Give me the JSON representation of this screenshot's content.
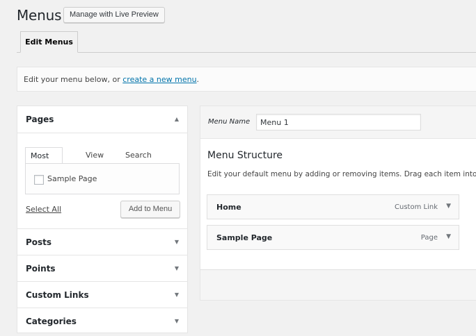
{
  "header": {
    "title": "Menus",
    "live_preview_label": "Manage with Live Preview"
  },
  "tabs": {
    "edit_menus": "Edit Menus"
  },
  "manage": {
    "text_before": "Edit your menu below, or ",
    "link_text": "create a new menu",
    "text_after": "."
  },
  "accordion": {
    "sections": [
      {
        "label": "Pages",
        "expanded": true,
        "arrow": "▲"
      },
      {
        "label": "Posts",
        "expanded": false,
        "arrow": "▼"
      },
      {
        "label": "Points",
        "expanded": false,
        "arrow": "▼"
      },
      {
        "label": "Custom Links",
        "expanded": false,
        "arrow": "▼"
      },
      {
        "label": "Categories",
        "expanded": false,
        "arrow": "▼"
      }
    ],
    "pages_tabs": [
      "Most Recent",
      "View All",
      "Search"
    ],
    "pages_items": [
      {
        "label": "Sample Page",
        "checked": false
      }
    ],
    "select_all": "Select All",
    "add_to_menu": "Add to Menu"
  },
  "menu": {
    "name_label": "Menu Name",
    "name_value": "Menu 1",
    "structure_title": "Menu Structure",
    "structure_desc": "Edit your default menu by adding or removing items. Drag each item into the",
    "items": [
      {
        "title": "Home",
        "type": "Custom Link",
        "arrow": "▼"
      },
      {
        "title": "Sample Page",
        "type": "Page",
        "arrow": "▼"
      }
    ]
  }
}
